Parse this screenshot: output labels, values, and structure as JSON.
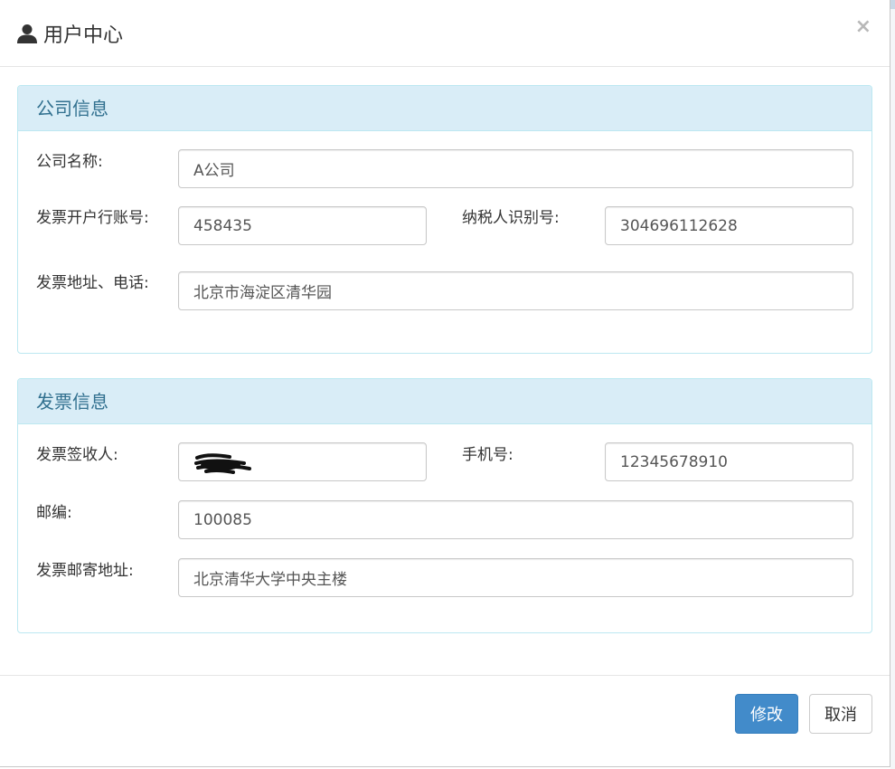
{
  "modal": {
    "title": "用户中心",
    "title_icon": "user-icon",
    "close_label": "×"
  },
  "company_panel": {
    "heading": "公司信息",
    "fields": {
      "company_name": {
        "label": "公司名称:",
        "value": "A公司"
      },
      "bank_account": {
        "label": "发票开户行账号:",
        "value": "458435"
      },
      "taxpayer_id": {
        "label": "纳税人识别号:",
        "value": "304696112628"
      },
      "address_phone": {
        "label": "发票地址、电话:",
        "value": "北京市海淀区清华园"
      }
    }
  },
  "invoice_panel": {
    "heading": "发票信息",
    "fields": {
      "recipient": {
        "label": "发票签收人:",
        "value": ""
      },
      "mobile": {
        "label": "手机号:",
        "value": "12345678910"
      },
      "postcode": {
        "label": "邮编:",
        "value": "100085"
      },
      "mail_address": {
        "label": "发票邮寄地址:",
        "value": "北京清华大学中央主楼"
      }
    }
  },
  "footer": {
    "submit_label": "修改",
    "cancel_label": "取消"
  },
  "colors": {
    "panel_heading_bg": "#d9edf7",
    "panel_heading_text": "#31708f",
    "panel_border": "#bce8f1",
    "primary_button": "#428bca"
  }
}
